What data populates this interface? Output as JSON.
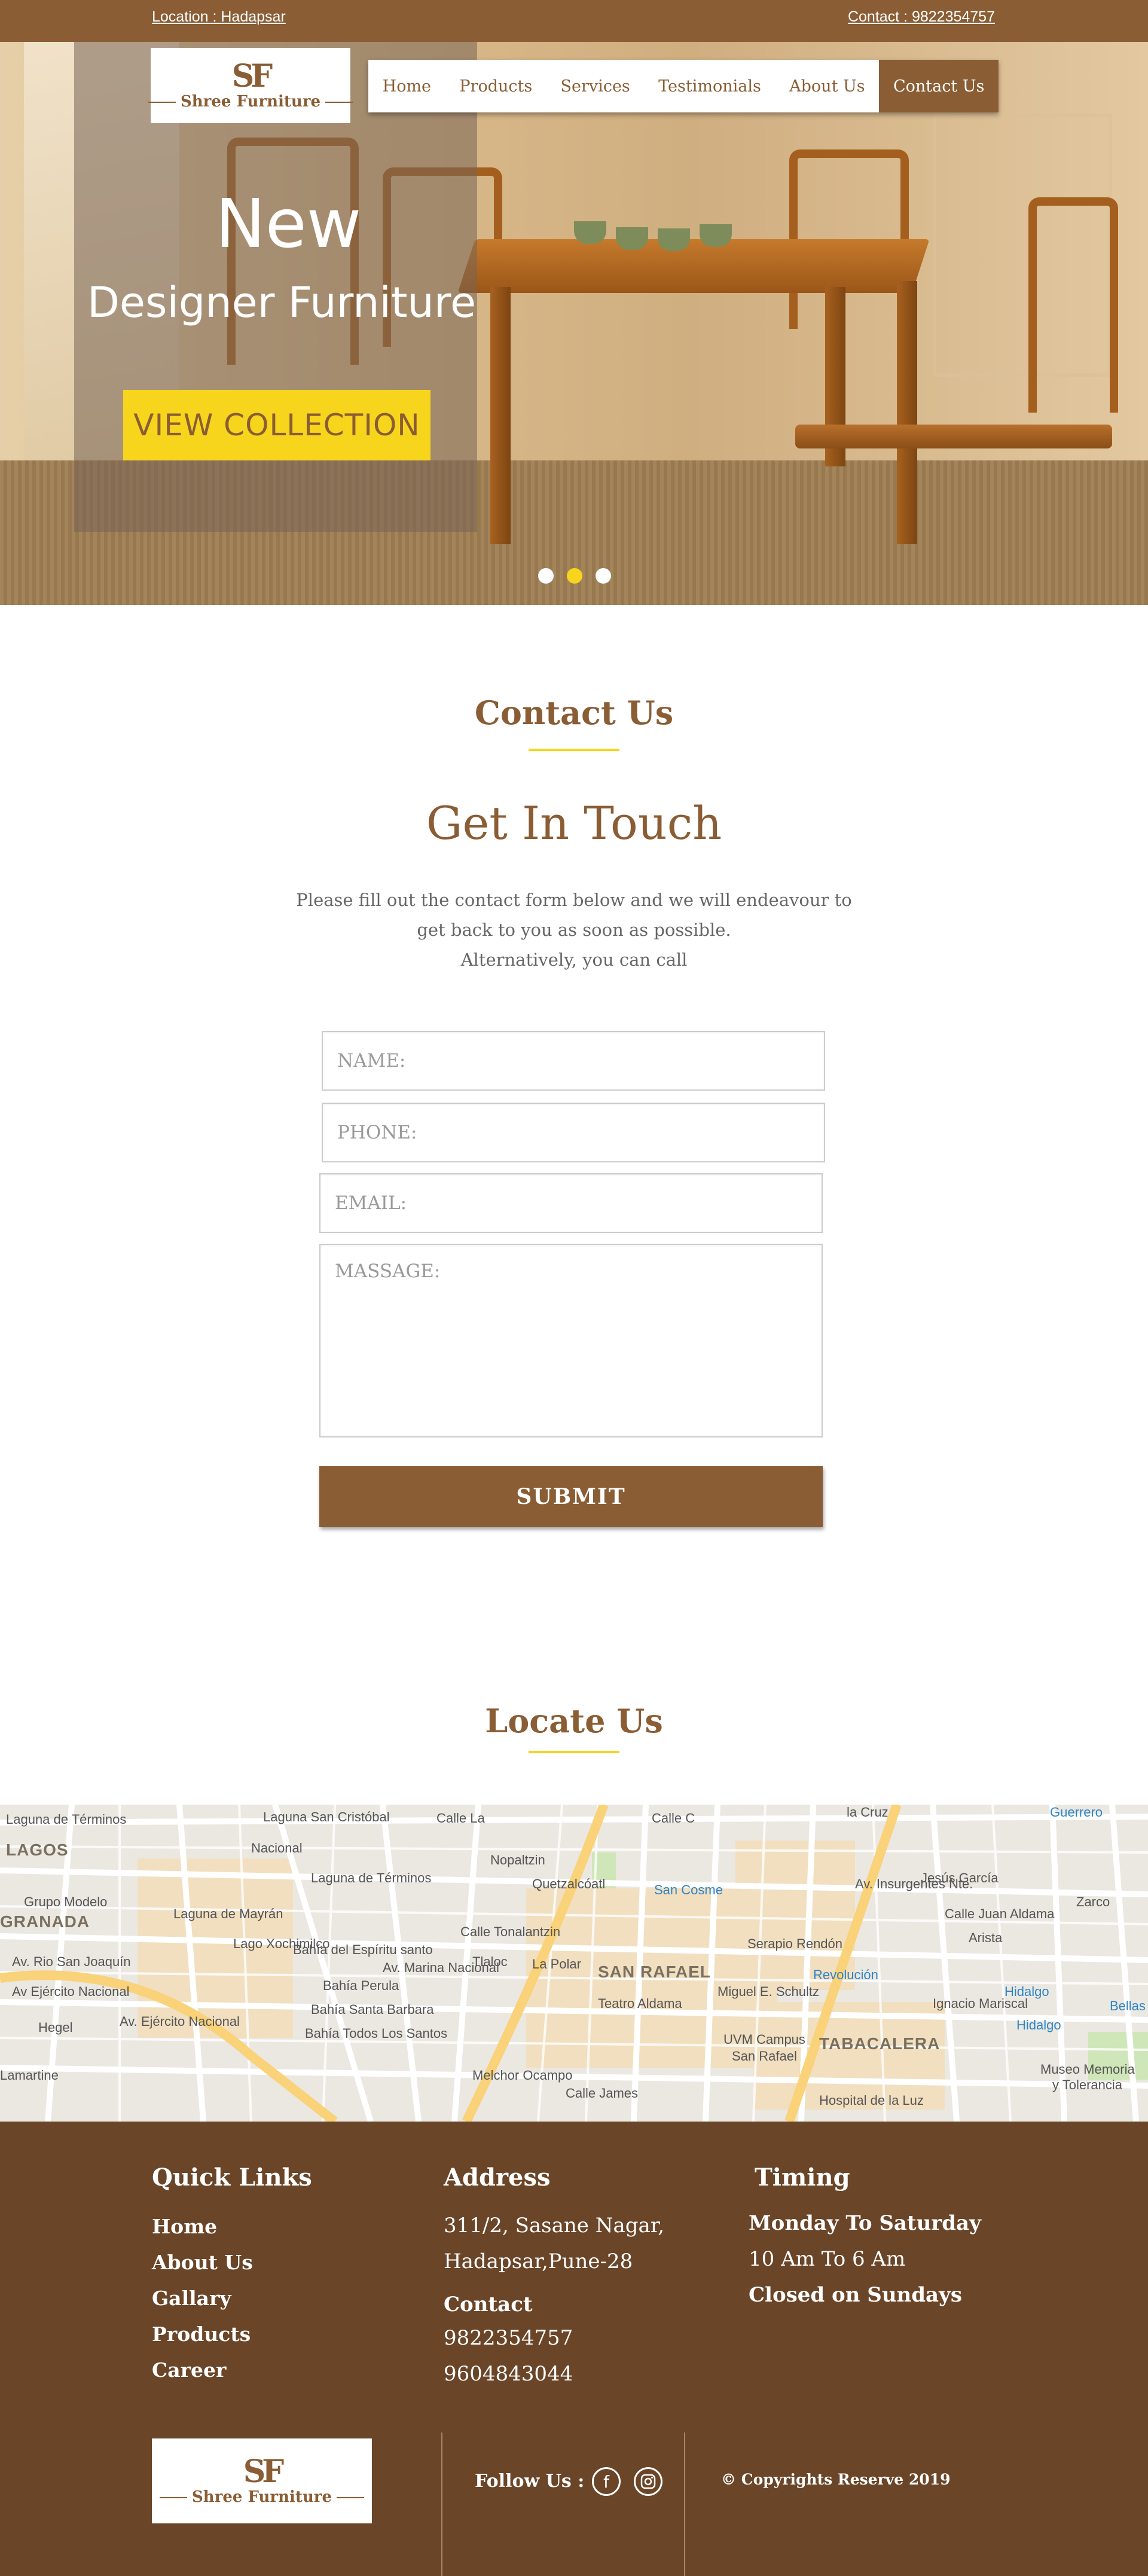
{
  "topbar": {
    "location": "Location : Hadapsar",
    "contact": "Contact : 9822354757"
  },
  "logo": {
    "mark": "SF",
    "name": "Shree Furniture"
  },
  "nav": {
    "items": [
      "Home",
      "Products",
      "Services",
      "Testimonials",
      "About Us",
      "Contact Us"
    ],
    "active": "Contact Us"
  },
  "hero": {
    "title": "New",
    "subtitle": "Designer Furniture",
    "cta": "VIEW COLLECTION",
    "slides": 3,
    "active_slide": 2
  },
  "contact": {
    "section_title": "Contact Us",
    "heading": "Get In Touch",
    "intro_line1": "Please fill out the contact form below and we will endeavour to",
    "intro_line2": "get back to you as soon as possible.",
    "intro_line3": "Alternatively, you can call",
    "form": {
      "name_placeholder": "NAME:",
      "phone_placeholder": "PHONE:",
      "email_placeholder": "EMAIL:",
      "message_placeholder": "MASSAGE:",
      "submit": "SUBMIT"
    }
  },
  "locate": {
    "section_title": "Locate Us",
    "map_labels": {
      "laguna_terminos_1": "Laguna de Términos",
      "laguna_san_cristobal": "Laguna San Cristóbal",
      "lagos": "LAGOS",
      "grupo_modelo": "Grupo Modelo",
      "granada": "GRANADA",
      "laguna_mayran": "Laguna de Mayrán",
      "laguna_terminos_2": "Laguna de Términos",
      "rio_san_joaquin": "Av. Rio San Joaquín",
      "ejercito_nacional_1": "Av Ejército Nacional",
      "bahia_espiritu_santo": "Bahía del Espíritu santo",
      "bahia_perula": "Bahía Perula",
      "bahia_santa_barbara": "Bahía Santa Barbara",
      "bahia_todos": "Bahía Todos Los Santos",
      "marina_nacional": "Av. Marina Nacional",
      "tonalantzin": "Calle Tonalantzin",
      "tlaloc": "Tlaloc",
      "nopaltzin": "Nopaltzin",
      "quetzalcoatl": "Quetzalcóatl",
      "la_polar": "La Polar",
      "san_rafael": "SAN RAFAEL",
      "teatro_aldama": "Teatro Aldama",
      "san_cosme": "San Cosme",
      "serapio_rendon": "Serapio Rendón",
      "miguel_schultz": "Miguel E. Schultz",
      "uvm_campus": "UVM Campus",
      "san_rafael_small": "San Rafael",
      "tabacalera": "TABACALERA",
      "hospital_luz": "Hospital de la Luz",
      "revolucion": "Revolución",
      "ignacio_mariscal": "Ignacio Mariscal",
      "hidalgo_1": "Hidalgo",
      "hidalgo_2": "Hidalgo",
      "museo_1": "Museo Memoria",
      "museo_2": "y Tolerancia",
      "insurgentes": "Av. Insurgentes Nte.",
      "jesus_garcia": "Jesús García",
      "juan_aldama": "Calle Juan Aldama",
      "arista": "Arista",
      "zarco": "Zarco",
      "guerrero": "Guerrero",
      "melchor_ocampo": "Melchor Ocampo",
      "calle_james": "Calle James",
      "calle_la": "Calle La",
      "calle_c": "Calle C",
      "la_cruz": "la Cruz",
      "hegel": "Hegel",
      "lamartine": "Lamartine",
      "bellas": "Bellas",
      "ejercito_nacional_2": "Av. Ejército Nacional",
      "lago_xochimilco": "Lago Xochimilco",
      "nacional": "Nacional"
    }
  },
  "footer": {
    "quick_links_title": "Quick Links",
    "links": [
      "Home",
      "About Us",
      "Gallary",
      "Products",
      "Career"
    ],
    "address_title": "Address",
    "address_line1": "311/2, Sasane Nagar,",
    "address_line2": "Hadapsar,Pune-28",
    "contact_title": "Contact",
    "phone1": "9822354757",
    "phone2": "9604843044",
    "timing_title": "Timing",
    "timing_days": "Monday To Saturday",
    "timing_hours": "10 Am To 6 Am",
    "timing_closed": "Closed on Sundays",
    "follow": "Follow Us :",
    "social_icons": [
      "facebook-icon",
      "instagram-icon"
    ],
    "copyright": "© Copyrights Reserve 2019"
  },
  "colors": {
    "brand_brown": "#8a5d34",
    "footer_brown": "#6a4528",
    "accent_yellow": "#f7d51d"
  }
}
